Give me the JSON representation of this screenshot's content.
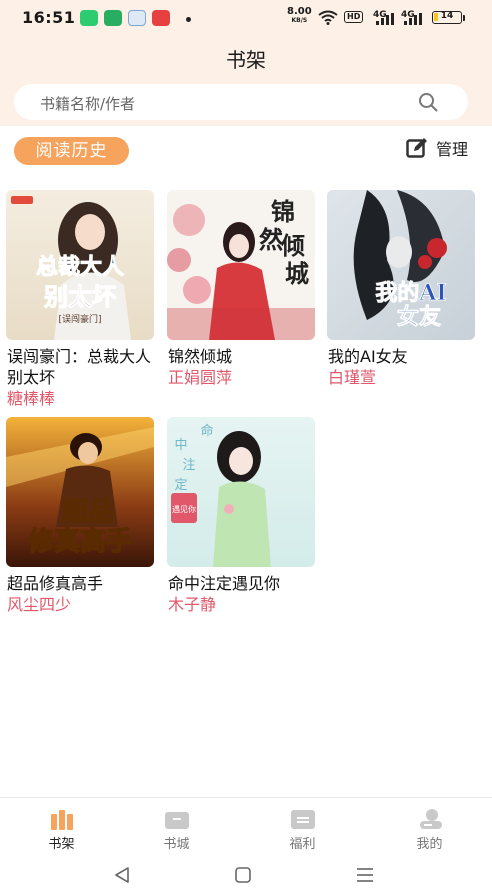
{
  "status_bar": {
    "time": "16:51",
    "net_speed": "8.00",
    "net_unit": "KB/S",
    "hd": "HD",
    "sim1": "4G",
    "sim2": "4G",
    "battery": "14",
    "battery_level": 0.14
  },
  "header": {
    "title": "书架"
  },
  "search": {
    "placeholder": "书籍名称/作者"
  },
  "history_button": "阅读历史",
  "manage_label": "管理",
  "books": [
    {
      "title": "误闯豪门：总裁大人别太坏",
      "author": "糖棒棒",
      "cover_text": [
        "总裁大人",
        "别太坏",
        "[误闯豪门]"
      ]
    },
    {
      "title": "锦然倾城",
      "author": "正娟圆萍",
      "cover_text": [
        "锦",
        "然",
        "倾",
        "城"
      ]
    },
    {
      "title": "我的AI女友",
      "author": "白瑾萱",
      "cover_text": [
        "我的AI",
        "女友"
      ]
    },
    {
      "title": "超品修真高手",
      "author": "风尘四少",
      "cover_text": [
        "超品",
        "修真高手"
      ]
    },
    {
      "title": "命中注定遇见你",
      "author": "木子静",
      "cover_text": [
        "命",
        "中",
        "注",
        "定",
        "遇见你"
      ]
    }
  ],
  "tabs": [
    {
      "label": "书架",
      "icon": "bookshelf-icon",
      "active": true
    },
    {
      "label": "书城",
      "icon": "bookstore-icon",
      "active": false
    },
    {
      "label": "福利",
      "icon": "welfare-icon",
      "active": false
    },
    {
      "label": "我的",
      "icon": "profile-icon",
      "active": false
    }
  ],
  "colors": {
    "accent": "#f6a35e",
    "author": "#e0586a",
    "header_bg": "#fdf0e6"
  }
}
